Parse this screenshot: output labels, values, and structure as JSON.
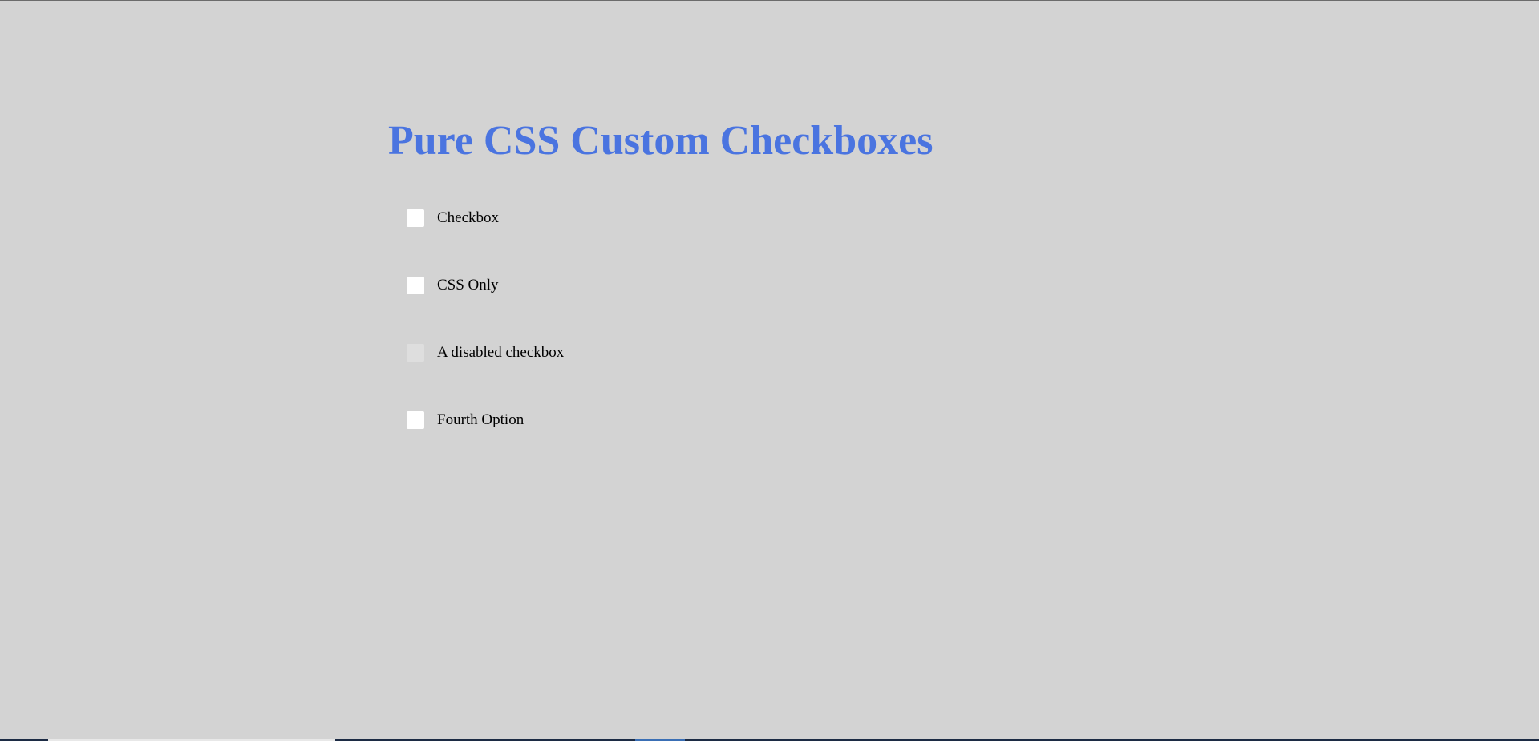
{
  "page": {
    "title": "Pure CSS Custom Checkboxes"
  },
  "colors": {
    "background": "#d3d3d3",
    "title": "#4a74e0",
    "checkbox": "#ffffff",
    "checkbox_disabled": "#dedede",
    "label": "#000000"
  },
  "checkboxes": [
    {
      "label": "Checkbox",
      "checked": false,
      "disabled": false
    },
    {
      "label": "CSS Only",
      "checked": false,
      "disabled": false
    },
    {
      "label": "A disabled checkbox",
      "checked": false,
      "disabled": true
    },
    {
      "label": "Fourth Option",
      "checked": false,
      "disabled": false
    }
  ]
}
